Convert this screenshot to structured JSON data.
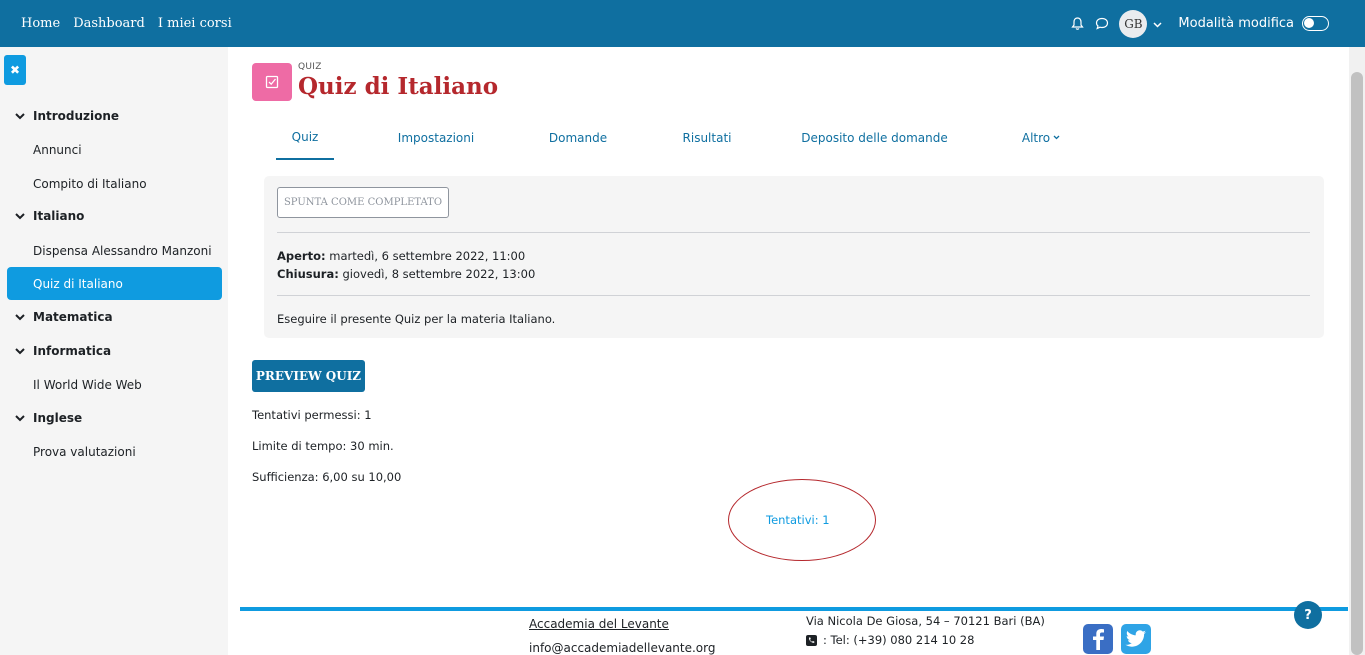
{
  "navbar": {
    "links": [
      "Home",
      "Dashboard",
      "I miei corsi"
    ],
    "avatar_initials": "GB",
    "edit_mode_label": "Modalità modifica"
  },
  "sidebar": {
    "items": [
      {
        "type": "section",
        "label": "Introduzione"
      },
      {
        "type": "item",
        "label": "Annunci"
      },
      {
        "type": "item",
        "label": "Compito di Italiano"
      },
      {
        "type": "section",
        "label": "Italiano"
      },
      {
        "type": "item",
        "label": "Dispensa Alessandro Manzoni"
      },
      {
        "type": "item",
        "label": "Quiz di Italiano",
        "active": true
      },
      {
        "type": "section",
        "label": "Matematica"
      },
      {
        "type": "section",
        "label": "Informatica"
      },
      {
        "type": "item",
        "label": "Il World Wide Web"
      },
      {
        "type": "section",
        "label": "Inglese"
      },
      {
        "type": "item",
        "label": "Prova valutazioni"
      }
    ]
  },
  "header": {
    "activity_type": "QUIZ",
    "title": "Quiz di Italiano"
  },
  "tabs": [
    "Quiz",
    "Impostazioni",
    "Domande",
    "Risultati",
    "Deposito delle domande",
    "Altro"
  ],
  "info": {
    "complete_button": "SPUNTA COME COMPLETATO",
    "opened_label": "Aperto:",
    "opened_value": "martedì, 6 settembre 2022, 11:00",
    "closed_label": "Chiusura:",
    "closed_value": "giovedì, 8 settembre 2022, 13:00",
    "description": "Eseguire il presente Quiz per la materia Italiano."
  },
  "quiz": {
    "preview_button": "PREVIEW QUIZ",
    "attempts_allowed": "Tentativi permessi: 1",
    "time_limit": "Limite di tempo: 30 min.",
    "passing_grade": "Sufficienza: 6,00 su 10,00",
    "attempts_link": "Tentativi: 1"
  },
  "footer": {
    "org": "Accademia del Levante",
    "email": "info@accademiadellevante.org",
    "address": "Via Nicola De Giosa, 54 – 70121 Bari (BA)",
    "tel": ": Tel: (+39) 080 214 10 28"
  },
  "help_label": "?",
  "colors": {
    "navbar": "#0f6fa0",
    "accent": "#0f9be0",
    "title": "#b5282d",
    "quiz_icon": "#ee6ba5"
  }
}
